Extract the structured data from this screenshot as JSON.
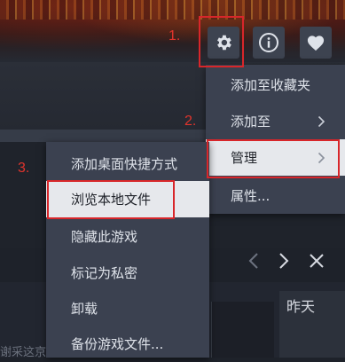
{
  "annotations": {
    "step1": "1.",
    "step2": "2.",
    "step3": "3."
  },
  "topbar": {
    "settings_icon": "gear-icon",
    "info_icon": "info-icon",
    "favorite_icon": "heart-icon"
  },
  "main_menu": {
    "items": [
      {
        "label": "添加至收藏夹",
        "has_submenu": false
      },
      {
        "label": "添加至",
        "has_submenu": true
      },
      {
        "label": "管理",
        "has_submenu": true,
        "highlighted": true
      },
      {
        "label": "属性...",
        "has_submenu": false
      }
    ]
  },
  "manage_submenu": {
    "items": [
      {
        "label": "添加桌面快捷方式"
      },
      {
        "label": "浏览本地文件",
        "highlighted": true
      },
      {
        "label": "隐藏此游戏"
      },
      {
        "label": "标记为私密"
      },
      {
        "label": "卸载"
      },
      {
        "label": "备份游戏文件..."
      }
    ]
  },
  "activity": {
    "prev_icon": "chevron-left-icon",
    "next_icon": "chevron-right-icon",
    "close_icon": "close-icon",
    "date_label": "昨天",
    "partial_text": "谢采这京"
  },
  "colors": {
    "annotation": "#d8262a",
    "menu_bg": "#3b4150",
    "highlight_bg": "#e6e8ec"
  }
}
